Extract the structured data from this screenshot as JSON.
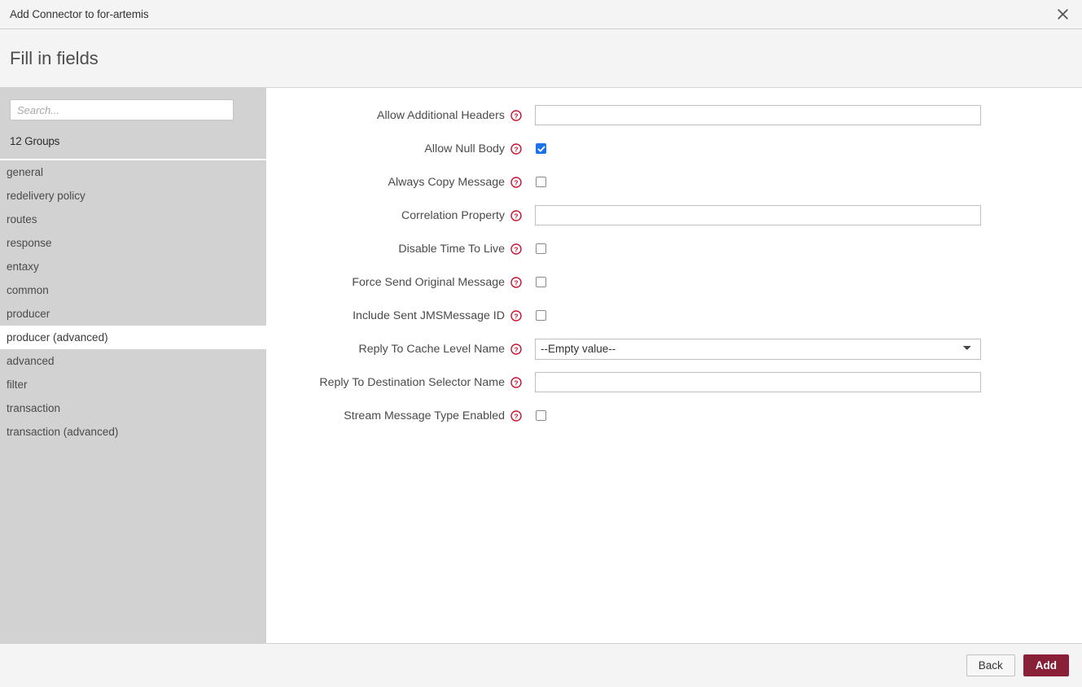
{
  "window": {
    "title": "Add Connector to for-artemis",
    "close_icon": "close-icon"
  },
  "step": {
    "title": "Fill in fields"
  },
  "sidebar": {
    "search": {
      "placeholder": "Search...",
      "value": ""
    },
    "groups_count_label": "12 Groups",
    "active_index": 7,
    "items": [
      {
        "label": "general"
      },
      {
        "label": "redelivery policy"
      },
      {
        "label": "routes"
      },
      {
        "label": "response"
      },
      {
        "label": "entaxy"
      },
      {
        "label": "common"
      },
      {
        "label": "producer"
      },
      {
        "label": "producer (advanced)"
      },
      {
        "label": "advanced"
      },
      {
        "label": "filter"
      },
      {
        "label": "transaction"
      },
      {
        "label": "transaction (advanced)"
      }
    ]
  },
  "form": {
    "help_icon": "help-circle-icon",
    "fields": [
      {
        "label": "Allow Additional Headers",
        "type": "text",
        "value": ""
      },
      {
        "label": "Allow Null Body",
        "type": "checkbox",
        "checked": true
      },
      {
        "label": "Always Copy Message",
        "type": "checkbox",
        "checked": false
      },
      {
        "label": "Correlation Property",
        "type": "text",
        "value": ""
      },
      {
        "label": "Disable Time To Live",
        "type": "checkbox",
        "checked": false
      },
      {
        "label": "Force Send Original Message",
        "type": "checkbox",
        "checked": false
      },
      {
        "label": "Include Sent JMSMessage ID",
        "type": "checkbox",
        "checked": false
      },
      {
        "label": "Reply To Cache Level Name",
        "type": "select",
        "value": "--Empty value--",
        "options": [
          "--Empty value--"
        ]
      },
      {
        "label": "Reply To Destination Selector Name",
        "type": "text",
        "value": ""
      },
      {
        "label": "Stream Message Type Enabled",
        "type": "checkbox",
        "checked": false
      }
    ]
  },
  "footer": {
    "back_label": "Back",
    "add_label": "Add"
  },
  "colors": {
    "accent_primary": "#8a1f38",
    "checkbox_checked": "#1a73e8",
    "help_icon": "#c8102e",
    "sidebar_bg": "#d2d2d2",
    "chrome_bg": "#f4f4f4"
  }
}
